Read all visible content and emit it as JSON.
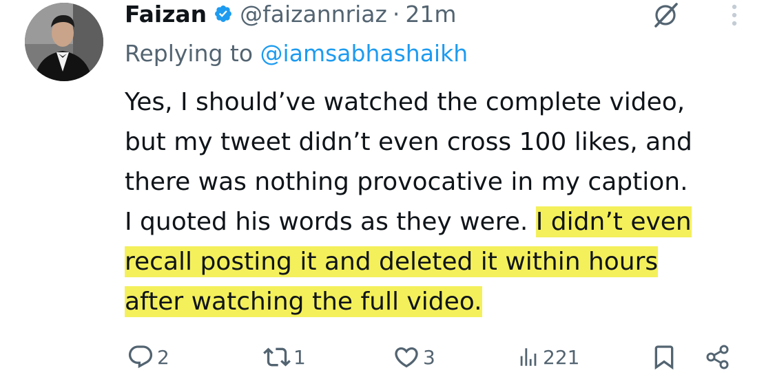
{
  "tweet": {
    "author_name": "Faizan",
    "handle": "@faizannriaz",
    "separator": "·",
    "time": "21m",
    "replying_prefix": "Replying to ",
    "replying_handle": "@iamsabhashaikh",
    "lines": [
      "Yes, I should’ve watched the complete video,",
      "but my tweet didn’t even cross 100 likes, and",
      "there was nothing provocative in my caption.",
      "I quoted his words as they were. ",
      "I didn’t even",
      "recall posting it and deleted it within hours",
      "after watching the full video."
    ]
  },
  "actions": {
    "replies": "2",
    "reposts": "1",
    "likes": "3",
    "views": "221"
  },
  "icons": {
    "verified": "verified-badge-icon",
    "grok": "grok-icon",
    "more": "more-options-icon",
    "reply": "reply-icon",
    "repost": "repost-icon",
    "like": "like-icon",
    "views": "views-icon",
    "bookmark": "bookmark-icon",
    "share": "share-icon"
  },
  "colors": {
    "text": "#0f1419",
    "secondary": "#536471",
    "link": "#1d9bf0",
    "highlight": "#f4f05b"
  }
}
